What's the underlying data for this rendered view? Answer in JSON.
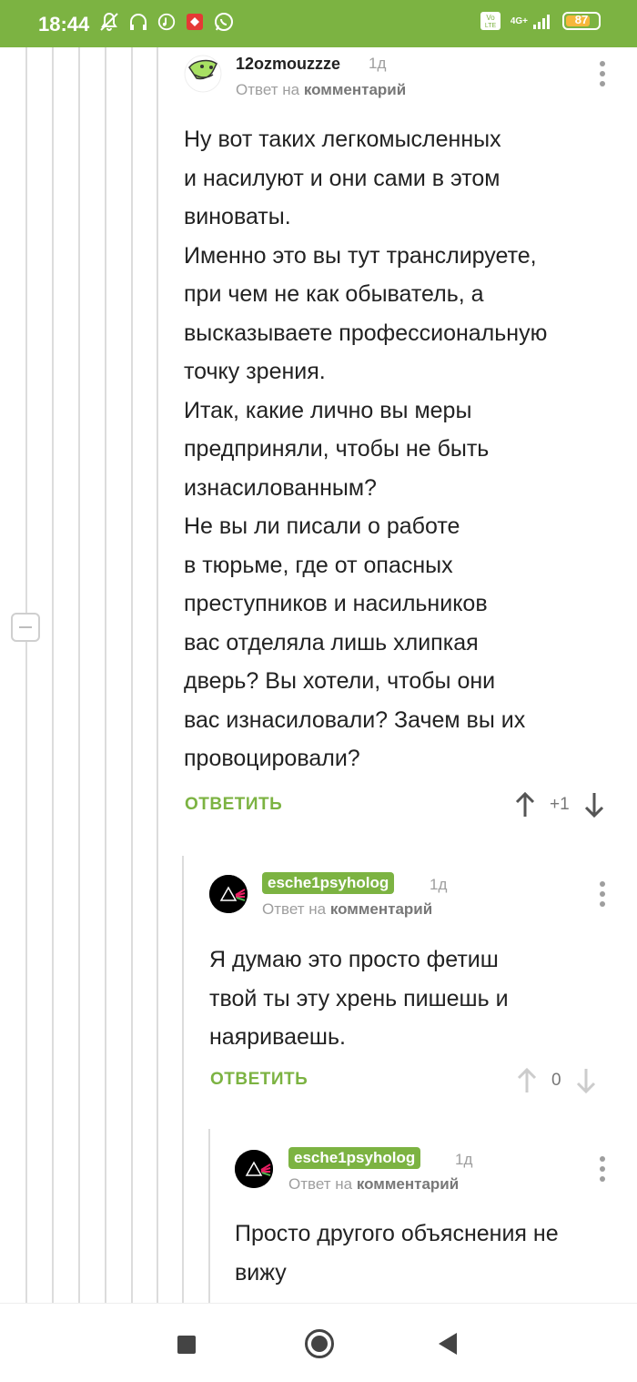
{
  "status_bar": {
    "time": "18:44",
    "network": "4G+",
    "battery": "87",
    "battery_level": 0.87
  },
  "comments": [
    {
      "username": "12ozmouzzze",
      "time": "1д",
      "reply_prefix": "Ответ на",
      "reply_target": "комментарий",
      "text": "Ну вот таких легкомысленных\nи насилуют и они сами в этом\nвиноваты.\nИменно это вы тут транслируете,\nпри чем не как обыватель, а\nвысказываете профессиональную\nточку зрения.\nИтак, какие лично вы меры\nпредприняли, чтобы не быть\nизнасилованным?\nНе вы ли писали о работе\nв тюрьме, где от опасных\nпреступников и насильников\nвас отделяла лишь хлипкая\nдверь? Вы хотели, чтобы они\nвас изнасиловали? Зачем вы их\nпровоцировали?",
      "reply_label": "ОТВЕТИТЬ",
      "score": "+1"
    },
    {
      "username": "esche1psyholog",
      "time": "1д",
      "reply_prefix": "Ответ на",
      "reply_target": "комментарий",
      "text": "Я думаю это просто фетиш\nтвой ты эту хрень пишешь и\nнаяриваешь.",
      "reply_label": "ОТВЕТИТЬ",
      "score": "0"
    },
    {
      "username": "esche1psyholog",
      "time": "1д",
      "reply_prefix": "Ответ на",
      "reply_target": "комментарий",
      "text": "Просто другого объяснения не\nвижу"
    }
  ],
  "colors": {
    "brand": "#7cb342",
    "muted": "#9e9e9e",
    "text": "#222222"
  },
  "icons": {
    "vote_up": "arrow-up-icon",
    "vote_down": "arrow-down-icon",
    "menu": "kebab-icon"
  }
}
